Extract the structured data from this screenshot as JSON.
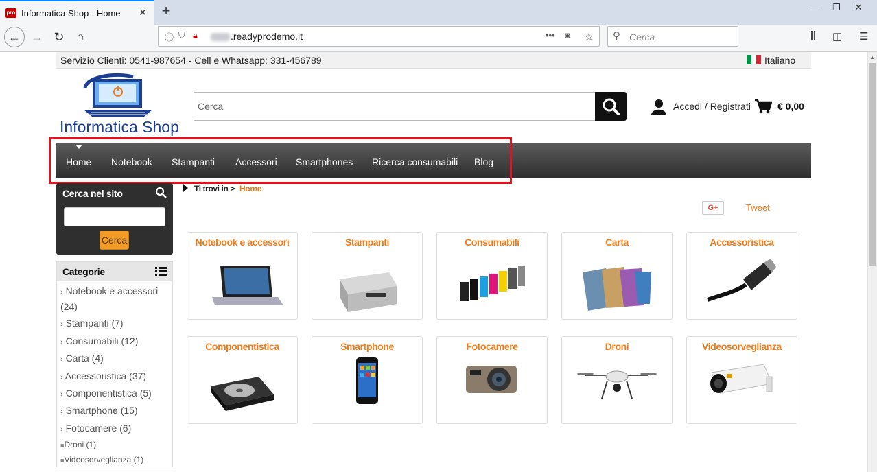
{
  "browser": {
    "tab_title": "Informatica Shop - Home",
    "favicon_text": "pro",
    "url_domain": ".readyprodemo.it",
    "search_placeholder": "Cerca"
  },
  "topbar": {
    "service": "Servizio Clienti: 0541-987654 - Cell e Whatsapp: 331-456789",
    "language": "Italiano"
  },
  "header": {
    "logo_text": "Informatica Shop",
    "search_placeholder": "Cerca",
    "login": "Accedi / Registrati",
    "cart_total": "€ 0,00"
  },
  "menu": [
    "Home",
    "Notebook",
    "Stampanti",
    "Accessori",
    "Smartphones",
    "Ricerca consumabili",
    "Blog"
  ],
  "sidebar": {
    "search_title": "Cerca nel sito",
    "search_button": "Cerca",
    "categories_title": "Categorie",
    "categories": [
      "Notebook e accessori (24)",
      "Stampanti (7)",
      "Consumabili (12)",
      "Carta (4)",
      "Accessoristica (37)",
      "Componentistica (5)",
      "Smartphone (15)",
      "Fotocamere (6)"
    ],
    "subcategories": [
      "Droni (1)",
      "Videosorveglianza (1)"
    ]
  },
  "breadcrumb": {
    "prefix": "Ti trovi in >",
    "current": "Home"
  },
  "social": {
    "gplus": "G+",
    "tweet": "Tweet"
  },
  "products": [
    "Notebook e accessori",
    "Stampanti",
    "Consumabili",
    "Carta",
    "Accessoristica",
    "Componentistica",
    "Smartphone",
    "Fotocamere",
    "Droni",
    "Videosorveglianza"
  ],
  "colors": {
    "accent": "#f07d1a",
    "menu_bg": "#3a3a3a",
    "highlight": "#e0141e",
    "logo": "#1a3f94"
  }
}
